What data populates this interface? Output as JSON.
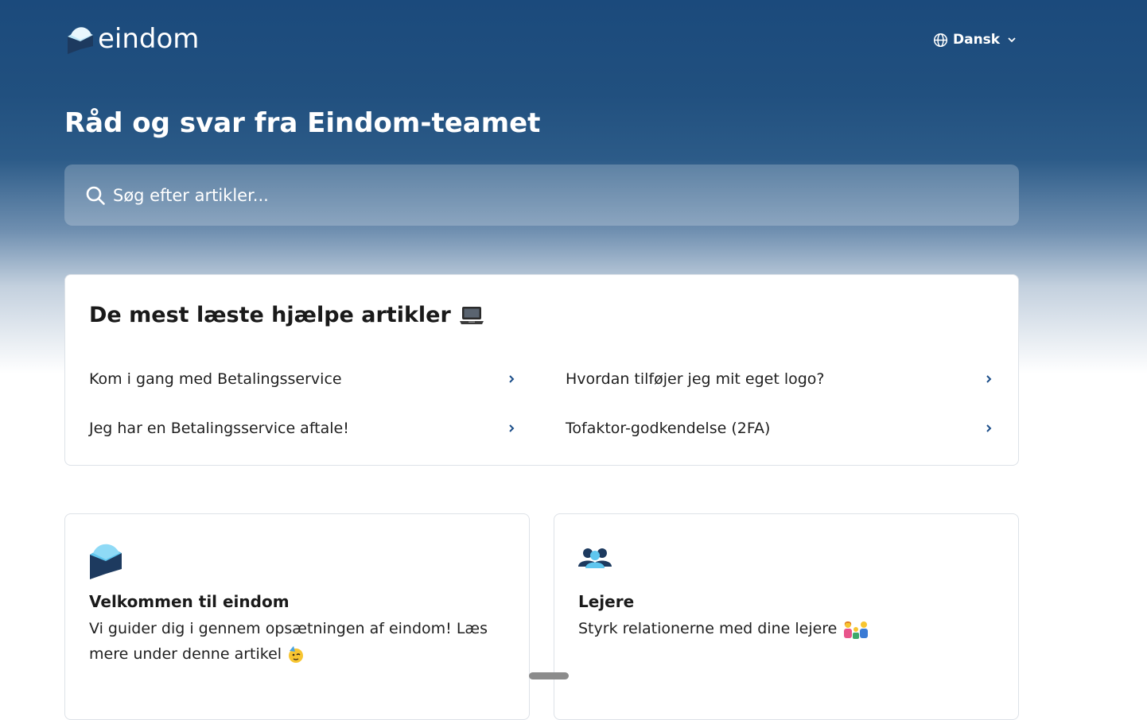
{
  "header": {
    "logo_text": "eindom",
    "language": "Dansk"
  },
  "hero": {
    "title": "Råd og svar fra Eindom-teamet",
    "search_placeholder": "Søg efter artikler..."
  },
  "popular": {
    "heading": "De mest læste hjælpe artikler",
    "heading_icon": "laptop-icon",
    "articles": [
      {
        "label": "Kom i gang med Betalingsservice"
      },
      {
        "label": "Hvordan tilføjer jeg mit eget logo?"
      },
      {
        "label": "Jeg har en Betalingsservice aftale!"
      },
      {
        "label": "Tofaktor-godkendelse (2FA)"
      }
    ]
  },
  "collections": [
    {
      "icon": "eindom-logo-icon",
      "title": "Velkommen til eindom",
      "description": "Vi guider dig i gennem opsætningen af eindom! Læs mere under denne artikel",
      "emoji": "partying-face-icon"
    },
    {
      "icon": "people-icon",
      "title": "Lejere",
      "description": "Styrk relationerne med dine lejere",
      "emoji": "family-icon"
    }
  ],
  "colors": {
    "hero_top": "#1b4a7c",
    "brand_light": "#7fd3f5",
    "brand_dark": "#1d3a5f",
    "accent_arrow": "#1d4f8a"
  }
}
